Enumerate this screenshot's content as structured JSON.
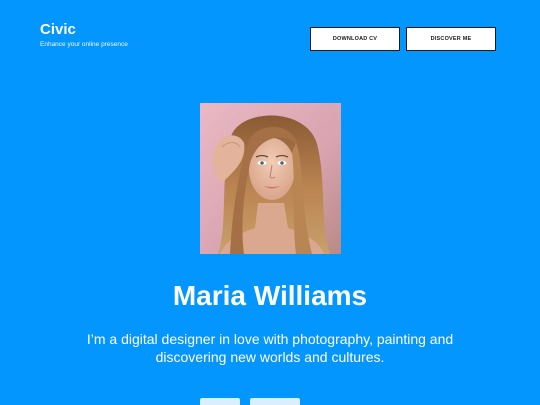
{
  "brand": {
    "name": "Civic",
    "tagline": "Enhance your online presence"
  },
  "header": {
    "download_label": "DOWNLOAD CV",
    "discover_label": "DISCOVER ME"
  },
  "profile": {
    "name": "Maria Williams",
    "bio": "I’m a digital designer in love with photography, painting and discovering new worlds and cultures."
  },
  "colors": {
    "background": "#0396ff",
    "text": "#ffffff",
    "button_bg": "#ffffff",
    "button_text": "#1a1a1a"
  }
}
